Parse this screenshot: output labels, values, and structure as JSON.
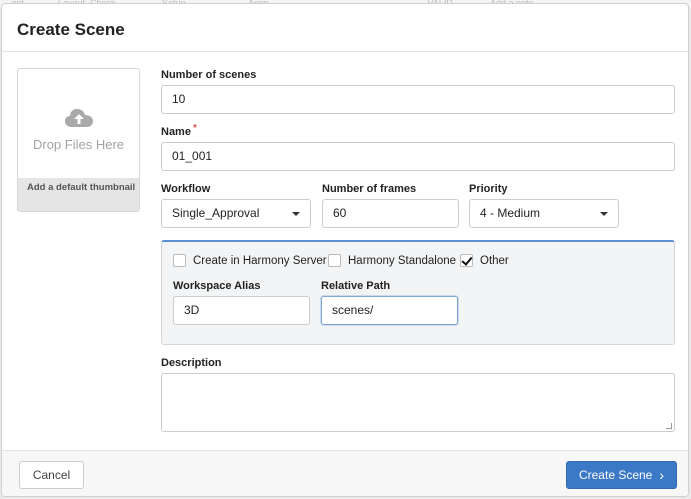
{
  "background_tabs": [
    "...ent",
    "Layout_Check",
    "Setup",
    "Anim",
    "...VALID",
    "Add a note"
  ],
  "modal": {
    "title": "Create Scene"
  },
  "thumbnail": {
    "icon": "cloud-upload-icon",
    "drop_text": "Drop Files Here",
    "footer_text": "Add a default thumbnail"
  },
  "form": {
    "num_scenes": {
      "label": "Number of scenes",
      "value": "10"
    },
    "name": {
      "label": "Name",
      "required_mark": "*",
      "value": "01_001"
    },
    "workflow": {
      "label": "Workflow",
      "value": "Single_Approval"
    },
    "num_frames": {
      "label": "Number of frames",
      "value": "60"
    },
    "priority": {
      "label": "Priority",
      "value": "4 - Medium"
    },
    "options": {
      "create_harmony_server": {
        "label": "Create in Harmony Server",
        "checked": false
      },
      "harmony_standalone": {
        "label": "Harmony Standalone",
        "checked": false
      },
      "other": {
        "label": "Other",
        "checked": true
      }
    },
    "workspace_alias": {
      "label": "Workspace Alias",
      "value": "3D"
    },
    "relative_path": {
      "label": "Relative Path",
      "value": "scenes/"
    },
    "description": {
      "label": "Description",
      "value": ""
    }
  },
  "footer": {
    "cancel_label": "Cancel",
    "create_label": "Create Scene",
    "create_icon": "chevron-right-icon"
  },
  "colors": {
    "primary": "#3b79c6",
    "focus_border": "#5b8fd2",
    "required": "#d9534f"
  }
}
